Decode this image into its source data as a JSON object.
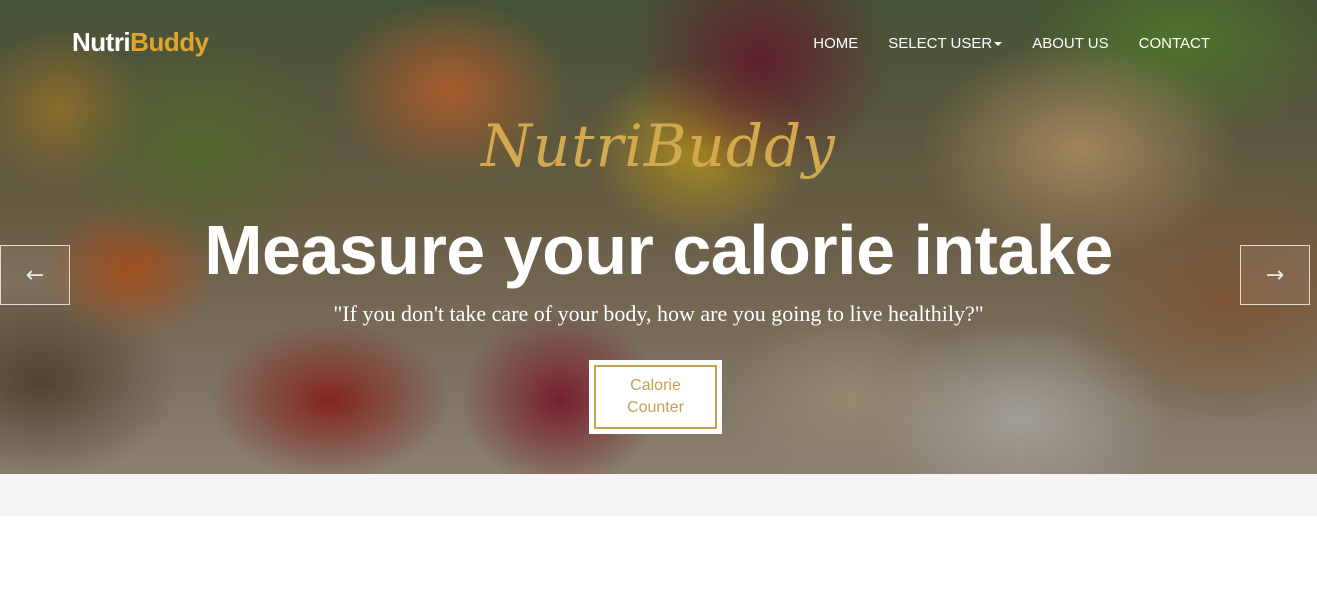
{
  "header": {
    "brand_part1": "Nutri",
    "brand_part2": "Buddy",
    "nav": {
      "home": "HOME",
      "select_user": "SELECT USER",
      "about": "ABOUT US",
      "contact": "CONTACT"
    }
  },
  "hero": {
    "script_title": "NutriBuddy",
    "headline": "Measure your calorie intake",
    "quote": "\"If you don't take care of your body, how are you going to live healthily?\"",
    "cta_label": "Calorie Counter",
    "prev_arrow": "←",
    "next_arrow": "→"
  },
  "colors": {
    "accent_gold": "#c7a050",
    "brand_orange": "#e0a431"
  },
  "icons": {
    "dropdown": "caret-down-icon",
    "prev": "arrow-left-icon",
    "next": "arrow-right-icon"
  }
}
